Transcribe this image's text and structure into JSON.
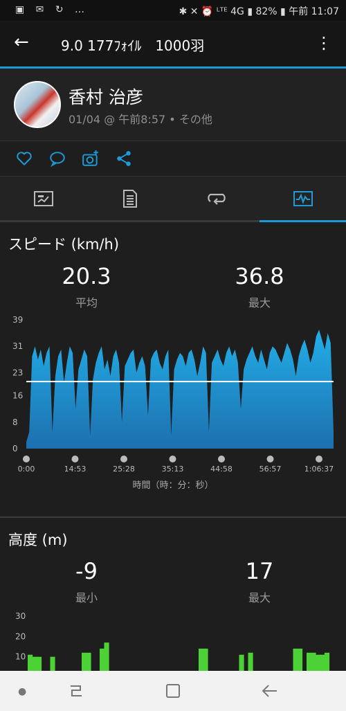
{
  "status_bar": {
    "left_icons": "▣ ✉ ↻ …",
    "right_text": "✱ ✕ ⏰ ᴸᵀᴱ 4G ▮ 82% ▮ 午前 11:07"
  },
  "app_bar": {
    "back_icon": "arrow-left-icon",
    "title": "9.0 177ﾌｫｲﾙ　1000羽",
    "more_icon": "more-vert-icon"
  },
  "profile": {
    "name": "香村 治彦",
    "meta": "01/04 @ 午前8:57 • その他"
  },
  "actions": [
    "heart-icon",
    "comment-icon",
    "add-photo-icon",
    "share-icon"
  ],
  "tabs": [
    "summary-icon",
    "details-icon",
    "laps-icon",
    "charts-icon"
  ],
  "active_tab": 3,
  "colors": {
    "accent": "#1e9ad6",
    "speed_fill": "#1e9ad6",
    "altitude_fill": "#4cd137"
  },
  "speed": {
    "title": "スピード (km/h)",
    "avg_value": "20.3",
    "avg_label": "平均",
    "max_value": "36.8",
    "max_label": "最大",
    "x_axis_title": "時間（時：分：秒）"
  },
  "altitude": {
    "title": "高度 (m)",
    "min_value": "-9",
    "min_label": "最小",
    "max_value": "17",
    "max_label": "最大"
  },
  "chart_data": [
    {
      "type": "area",
      "ylabel": "スピード (km/h)",
      "xlabel": "時間（時：分：秒）",
      "ylim": [
        0,
        39
      ],
      "y_ticks": [
        "39",
        "31",
        "23",
        "16",
        "8",
        "0"
      ],
      "x_ticks": [
        "0:00",
        "14:53",
        "25:28",
        "35:13",
        "44:58",
        "56:57",
        "1:06:37"
      ],
      "average_line": 20.3,
      "max": 36.8,
      "values": [
        2,
        5,
        28,
        31,
        27,
        30,
        25,
        29,
        31,
        5,
        22,
        28,
        30,
        20,
        26,
        31,
        29,
        12,
        24,
        27,
        30,
        28,
        4,
        21,
        26,
        29,
        31,
        24,
        27,
        22,
        28,
        30,
        26,
        8,
        25,
        27,
        29,
        30,
        23,
        26,
        28,
        25,
        10,
        27,
        29,
        30,
        26,
        24,
        28,
        30,
        4,
        24,
        27,
        29,
        28,
        25,
        29,
        30,
        27,
        22,
        26,
        31,
        29,
        5,
        26,
        28,
        30,
        27,
        25,
        29,
        31,
        28,
        30,
        26,
        12,
        24,
        27,
        29,
        31,
        28,
        26,
        30,
        27,
        24,
        29,
        31,
        30,
        28,
        26,
        29,
        32,
        30,
        27,
        22,
        28,
        31,
        33,
        30,
        26,
        29,
        34,
        36,
        33,
        30,
        35,
        32,
        5
      ]
    },
    {
      "type": "area",
      "ylabel": "高度 (m)",
      "ylim": [
        0,
        30
      ],
      "y_ticks": [
        "30",
        "20",
        "10"
      ],
      "min": -9,
      "max": 17,
      "values": [
        11,
        10,
        10,
        0,
        0,
        10,
        0,
        0,
        0,
        0,
        0,
        0,
        12,
        12,
        0,
        0,
        14,
        17,
        0,
        0,
        0,
        0,
        0,
        0,
        0,
        0,
        0,
        0,
        0,
        0,
        0,
        0,
        0,
        0,
        0,
        0,
        0,
        0,
        14,
        14,
        0,
        0,
        0,
        0,
        0,
        0,
        0,
        11,
        0,
        12,
        0,
        0,
        0,
        0,
        0,
        0,
        0,
        0,
        0,
        14,
        14,
        0,
        12,
        12,
        11,
        11,
        12,
        0
      ]
    }
  ]
}
